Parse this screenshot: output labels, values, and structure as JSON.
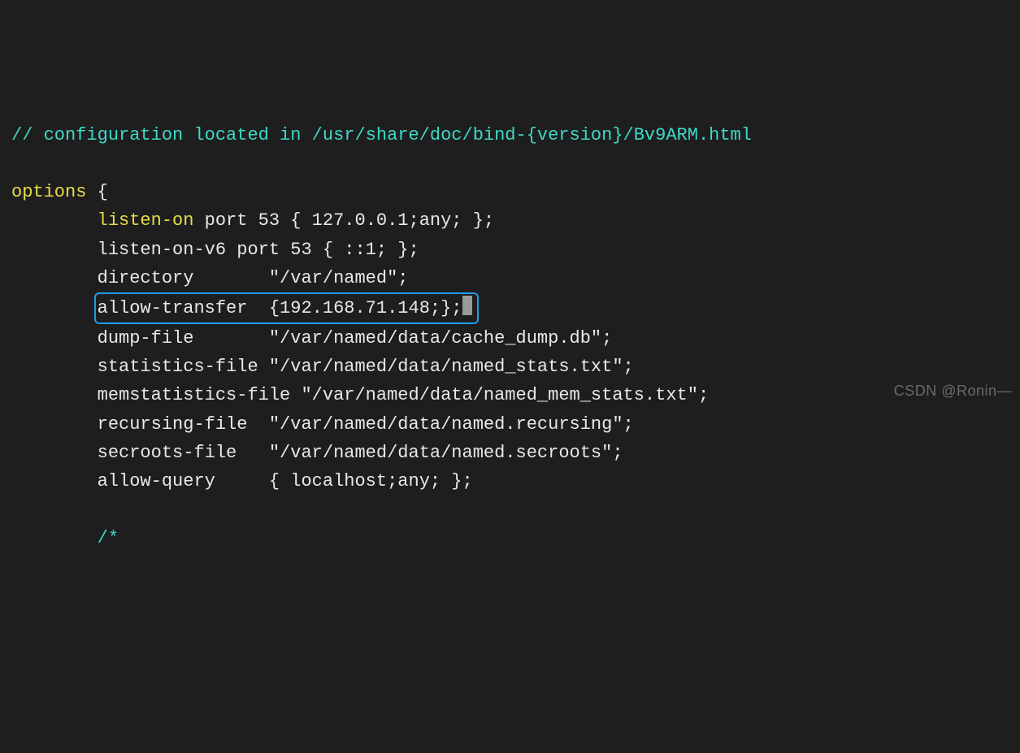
{
  "comment_line": "// configuration located in /usr/share/doc/bind-{version}/Bv9ARM.html",
  "options_keyword": "options",
  "brace_open": " {",
  "indent": "        ",
  "listen_on_kw": "listen-on",
  "listen_on_rest": " port 53 { 127.0.0.1;any; };",
  "listen_on_v6": "listen-on-v6 port 53 { ::1; };",
  "directory_line": "directory       \"/var/named\";",
  "allow_transfer_line": "allow-transfer  {192.168.71.148;};",
  "dump_file_line": "dump-file       \"/var/named/data/cache_dump.db\";",
  "statistics_file_line": "statistics-file \"/var/named/data/named_stats.txt\";",
  "memstatistics_file_line": "memstatistics-file \"/var/named/data/named_mem_stats.txt\";",
  "recursing_file_line": "recursing-file  \"/var/named/data/named.recursing\";",
  "secroots_file_line": "secroots-file   \"/var/named/data/named.secroots\";",
  "allow_query_line": "allow-query     { localhost;any; };",
  "comment_start": "/*",
  "watermark": "CSDN @Ronin—"
}
